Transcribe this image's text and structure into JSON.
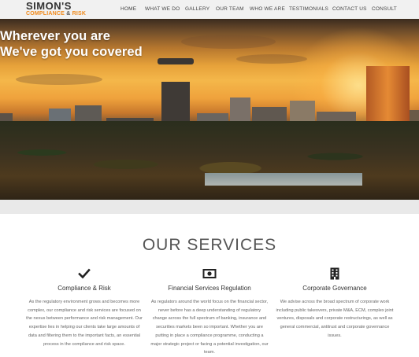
{
  "logo": {
    "top": "SIMON'S",
    "bottom_left": "COMPLIANCE",
    "bottom_amp": "&",
    "bottom_right": "RISK"
  },
  "nav": [
    "HOME",
    "WHAT WE DO",
    "GALLERY",
    "OUR TEAM",
    "WHO WE ARE",
    "TESTIMONIALS",
    "CONTACT US",
    "CONSULT"
  ],
  "hero": {
    "line1": "Wherever you are",
    "line2": "We've got you covered"
  },
  "services": {
    "title": "OUR SERVICES",
    "items": [
      {
        "icon": "checkmark-icon",
        "title": "Compliance & Risk",
        "desc": "As the regulatory environment grows and becomes more complex, our compliance and risk services are focused on the nexus between performance and risk management. Our expertise lies in helping our clients take large amounts of data and filtering them to the important facts, an essential process in the compliance and risk space."
      },
      {
        "icon": "money-icon",
        "title": "Financial Services Regulation",
        "desc": "As regulators around the world focus on the financial sector, never before has a deep understanding of regulatory change across the full spectrum of banking, insurance and securities markets been so important. Whether you are putting in place a compliance programme, conducting a major strategic project or facing a potential investigation, our team."
      },
      {
        "icon": "building-icon",
        "title": "Corporate Governance",
        "desc": "We advise across the broad spectrum of corporate work including public takeovers, private M&A, ECM, complex joint ventures, disposals and corporate restructurings, as well as general commercial, antitrust and corporate governance issues."
      }
    ]
  },
  "colors": {
    "accent": "#f08a1c",
    "header_bg": "#f1f1f1"
  }
}
